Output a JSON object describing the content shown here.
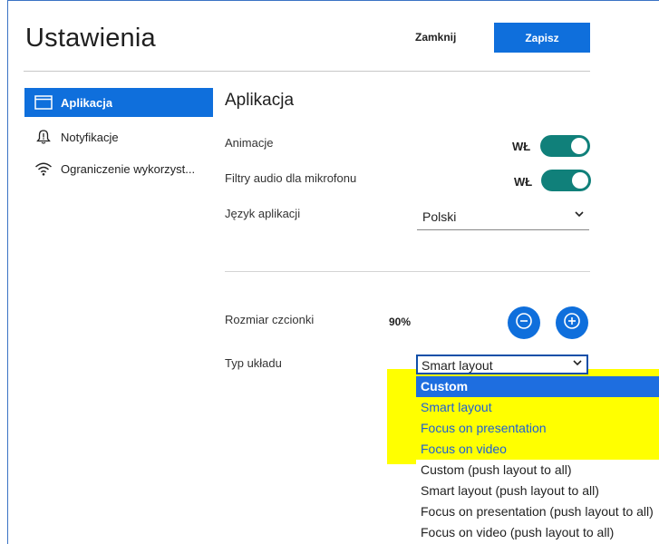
{
  "header": {
    "title": "Ustawienia",
    "close_label": "Zamknij",
    "save_label": "Zapisz"
  },
  "sidebar": {
    "items": [
      {
        "label": "Aplikacja",
        "icon": "window-icon",
        "active": true
      },
      {
        "label": "Notyfikacje",
        "icon": "bell-icon",
        "active": false
      },
      {
        "label": "Ograniczenie wykorzyst...",
        "icon": "wifi-icon",
        "active": false
      }
    ]
  },
  "main": {
    "section_title": "Aplikacja",
    "animations": {
      "label": "Animacje",
      "state": "WŁ",
      "on": true
    },
    "audio_filters": {
      "label": "Filtry audio dla mikrofonu",
      "state": "WŁ",
      "on": true
    },
    "language": {
      "label": "Język aplikacji",
      "value": "Polski"
    },
    "font_size": {
      "label": "Rozmiar czcionki",
      "value": "90%"
    },
    "layout": {
      "label": "Typ układu",
      "value": "Smart layout",
      "options": [
        {
          "label": "Custom",
          "selected": true,
          "highlighted": true
        },
        {
          "label": "Smart layout",
          "selected": false,
          "highlighted": true
        },
        {
          "label": "Focus on presentation",
          "selected": false,
          "highlighted": true
        },
        {
          "label": "Focus on video",
          "selected": false,
          "highlighted": true
        },
        {
          "label": "Custom (push layout to all)",
          "selected": false,
          "highlighted": false
        },
        {
          "label": "Smart layout (push layout to all)",
          "selected": false,
          "highlighted": false
        },
        {
          "label": "Focus on presentation (push layout to all)",
          "selected": false,
          "highlighted": false
        },
        {
          "label": "Focus on video (push layout to all)",
          "selected": false,
          "highlighted": false
        }
      ]
    }
  },
  "colors": {
    "primary": "#0f6fdc",
    "toggle_on": "#10807a",
    "highlight": "#ffff00"
  }
}
